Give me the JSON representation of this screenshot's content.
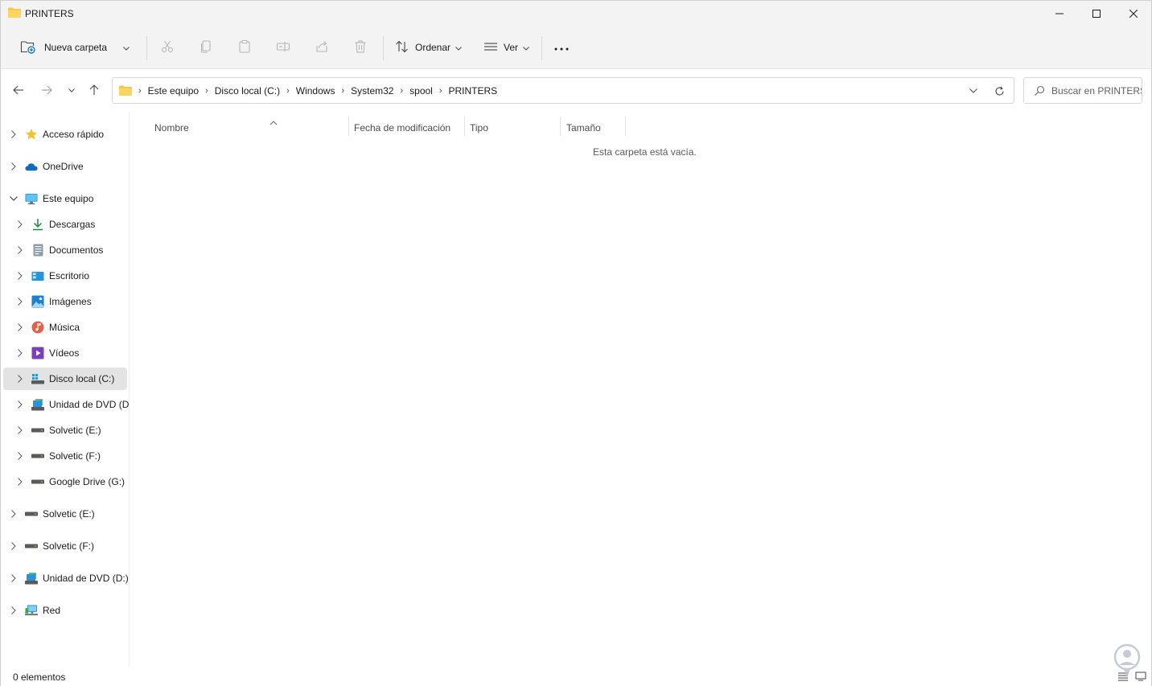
{
  "window": {
    "title": "PRINTERS"
  },
  "commandbar": {
    "new_folder": "Nueva carpeta",
    "sort": "Ordenar",
    "view": "Ver"
  },
  "address": {
    "crumbs": [
      "Este equipo",
      "Disco local (C:)",
      "Windows",
      "System32",
      "spool",
      "PRINTERS"
    ],
    "search_placeholder": "Buscar en PRINTERS"
  },
  "sidebar": {
    "items": [
      {
        "label": "Acceso rápido",
        "icon": "star-icon"
      },
      {
        "label": "OneDrive",
        "icon": "cloud-icon"
      },
      {
        "label": "Este equipo",
        "icon": "computer-icon"
      },
      {
        "label": "Descargas",
        "icon": "download-icon"
      },
      {
        "label": "Documentos",
        "icon": "document-icon"
      },
      {
        "label": "Escritorio",
        "icon": "desktop-icon"
      },
      {
        "label": "Imágenes",
        "icon": "pictures-icon"
      },
      {
        "label": "Música",
        "icon": "music-icon"
      },
      {
        "label": "Vídeos",
        "icon": "videos-icon"
      },
      {
        "label": "Disco local (C:)",
        "icon": "windows-drive-icon"
      },
      {
        "label": "Unidad de DVD (D:",
        "icon": "dvd-drive-icon"
      },
      {
        "label": "Solvetic (E:)",
        "icon": "drive-icon"
      },
      {
        "label": "Solvetic (F:)",
        "icon": "drive-icon"
      },
      {
        "label": "Google Drive (G:)",
        "icon": "drive-icon"
      },
      {
        "label": "Solvetic (E:)",
        "icon": "drive-icon"
      },
      {
        "label": "Solvetic (F:)",
        "icon": "drive-icon"
      },
      {
        "label": "Unidad de DVD (D:)",
        "icon": "dvd-drive-icon"
      },
      {
        "label": "Red",
        "icon": "network-icon"
      }
    ],
    "selected": "Disco local (C:)"
  },
  "columns": [
    "Nombre",
    "Fecha de modificación",
    "Tipo",
    "Tamaño"
  ],
  "content": {
    "empty_message": "Esta carpeta está vacía."
  },
  "status": {
    "count": "0 elementos"
  },
  "colors": {
    "accent": "#0067c0",
    "folder": "#f8c443",
    "selection": "#e3e3e3"
  }
}
